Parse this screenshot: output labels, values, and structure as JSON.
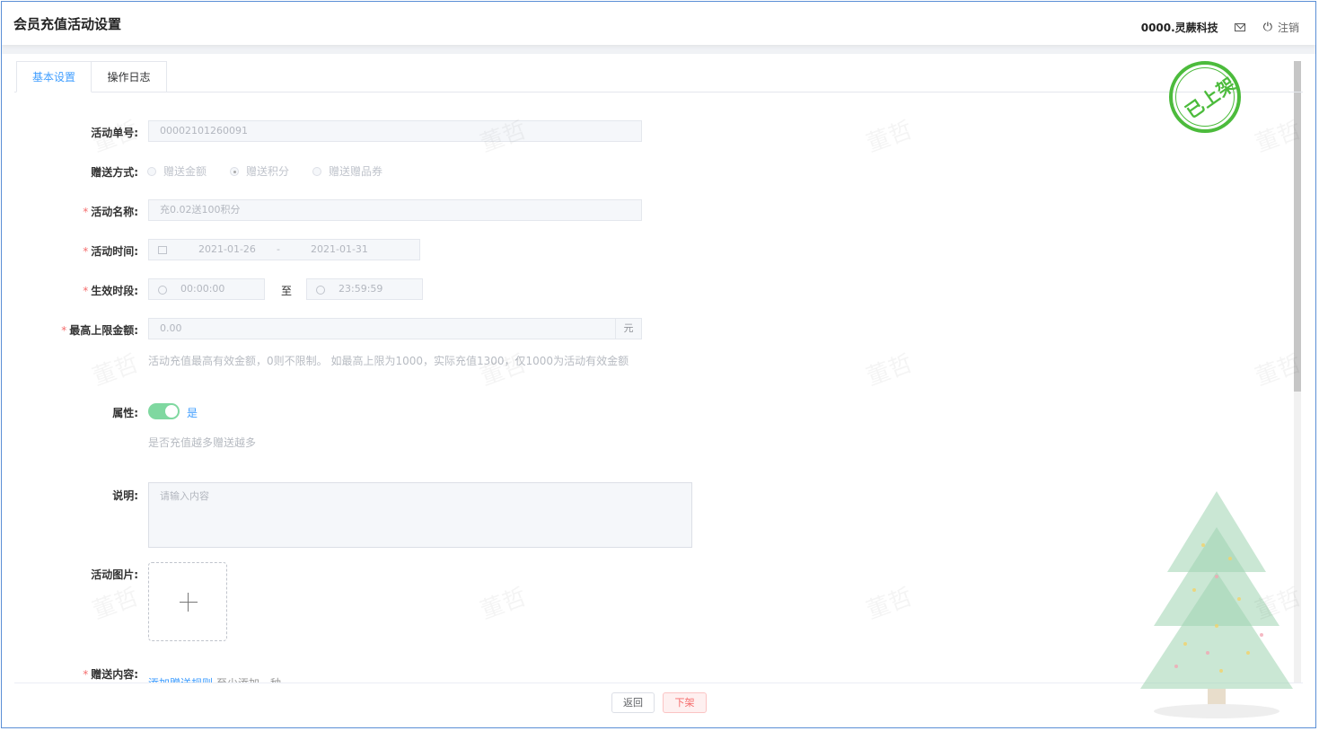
{
  "header": {
    "title": "会员充值活动设置",
    "company": "0000.灵蕨科技",
    "logout_label": "注销"
  },
  "tabs": [
    {
      "label": "基本设置",
      "active": true
    },
    {
      "label": "操作日志",
      "active": false
    }
  ],
  "stamp": {
    "text": "已上架",
    "color": "#4cbb3c"
  },
  "form": {
    "order_no": {
      "label": "活动单号:",
      "value": "00002101260091"
    },
    "gift_method": {
      "label": "赠送方式:",
      "options": [
        "赠送金额",
        "赠送积分",
        "赠送赠品券"
      ],
      "selected": "赠送积分"
    },
    "name": {
      "label": "活动名称:",
      "value": "充0.02送100积分"
    },
    "time": {
      "label": "活动时间:",
      "start": "2021-01-26",
      "separator": "-",
      "end": "2021-01-31"
    },
    "period": {
      "label": "生效时段:",
      "start": "00:00:00",
      "to": "至",
      "end": "23:59:59"
    },
    "max_amount": {
      "label": "最高上限金额:",
      "value": "0.00",
      "unit": "元",
      "hint": "活动充值最高有效金额，0则不限制。 如最高上限为1000，实际充值1300，仅1000为活动有效金额"
    },
    "attribute": {
      "label": "属性:",
      "switch_on": true,
      "switch_text": "是",
      "hint": "是否充值越多赠送越多"
    },
    "description": {
      "label": "说明:",
      "placeholder": "请输入内容"
    },
    "image": {
      "label": "活动图片:"
    },
    "gift_content": {
      "label": "赠送内容:",
      "link": "添加赠送规则",
      "hint": "至少添加一种"
    }
  },
  "footer": {
    "back_label": "返回",
    "off_shelf_label": "下架"
  },
  "watermark": "董哲",
  "colors": {
    "accent": "#409eff",
    "danger": "#f56c6c",
    "switch": "#7fd8a0",
    "stamp": "#4cbb3c"
  }
}
